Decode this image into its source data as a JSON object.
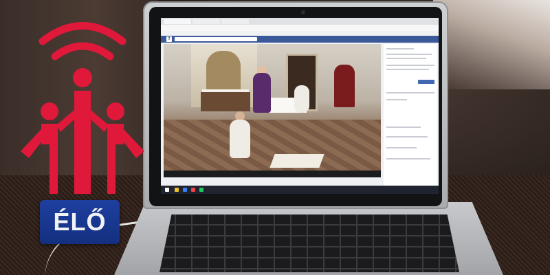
{
  "scene": {
    "description_elements": [
      "laptop",
      "livestream-video",
      "logo",
      "badge"
    ]
  },
  "badge": {
    "label": "ÉLŐ",
    "background_color": "#1e3fa0",
    "text_color": "#f1f2f6"
  },
  "logo": {
    "color": "#e0183a",
    "icon": "broadcast-people-icon"
  },
  "screen": {
    "site": "facebook",
    "fb_logo": "f"
  },
  "colors": {
    "facebook_blue": "#3b5998",
    "laptop_silver": "#b9bbbe"
  }
}
